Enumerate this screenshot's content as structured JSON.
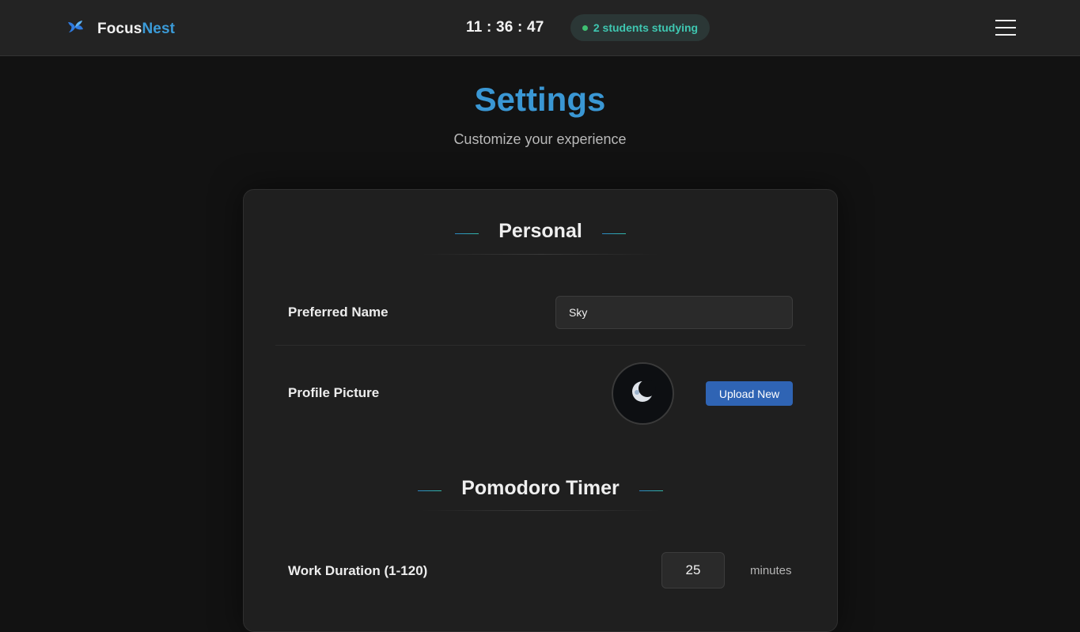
{
  "navbar": {
    "brand_part1": "Focus",
    "brand_part2": "Nest",
    "brand_accent_color": "#3b9bd8",
    "clock": "11 : 36 : 47",
    "studying_status": "2 students studying",
    "menu_icon": "hamburger-menu-icon"
  },
  "page": {
    "title": "Settings",
    "subtitle": "Customize your experience"
  },
  "sections": {
    "personal": {
      "heading": "Personal",
      "preferred_name_label": "Preferred Name",
      "preferred_name_value": "Sky",
      "profile_picture_label": "Profile Picture",
      "avatar_icon": "crescent-moon-icon",
      "upload_button": "Upload New"
    },
    "pomodoro": {
      "heading": "Pomodoro Timer",
      "work_duration_label": "Work Duration (1-120)",
      "work_duration_value": "25",
      "work_duration_unit": "minutes"
    }
  }
}
